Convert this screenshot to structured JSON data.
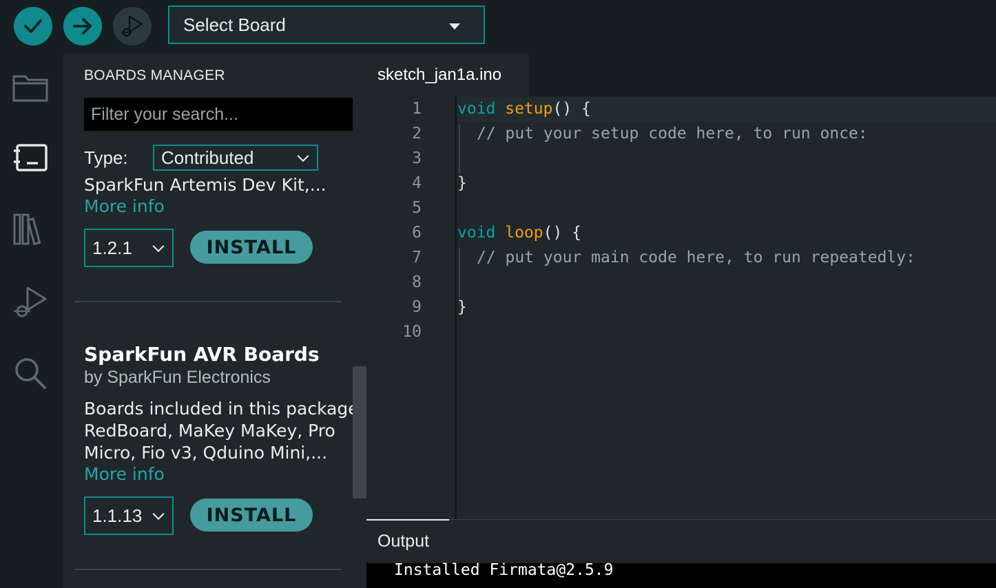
{
  "toolbar": {
    "verify_icon": "check-icon",
    "upload_icon": "arrow-right-icon",
    "debug_icon": "debug-play-icon",
    "board_select_label": "Select Board"
  },
  "activity_bar": {
    "items": [
      "folder-icon",
      "board-icon",
      "library-icon",
      "debug-icon",
      "search-icon"
    ],
    "active": "board-icon"
  },
  "boards_manager": {
    "title": "BOARDS MANAGER",
    "filter_placeholder": "Filter your search...",
    "type_label": "Type:",
    "type_value": "Contributed",
    "entries": [
      {
        "description": "SparkFun Artemis Dev Kit,...",
        "more_info": "More info",
        "version": "1.2.1",
        "install_label": "INSTALL"
      },
      {
        "name": "SparkFun AVR Boards",
        "author": "by SparkFun Electronics",
        "description_lines": [
          "Boards included in this package:",
          "RedBoard, MaKey MaKey, Pro",
          "Micro, Fio v3, Qduino Mini,..."
        ],
        "more_info": "More info",
        "version": "1.1.13",
        "install_label": "INSTALL"
      }
    ]
  },
  "editor": {
    "tab_name": "sketch_jan1a.ino",
    "line_numbers": [
      "1",
      "2",
      "3",
      "4",
      "5",
      "6",
      "7",
      "8",
      "9",
      "10"
    ],
    "lines": {
      "l1_kw": "void",
      "l1_fn": "setup",
      "l1_rest": "() {",
      "l2_comment": "// put your setup code here, to run once:",
      "l4": "}",
      "l6_kw": "void",
      "l6_fn": "loop",
      "l6_rest": "() {",
      "l7_comment": "// put your main code here, to run repeatedly:",
      "l9": "}"
    }
  },
  "output": {
    "title": "Output",
    "text": "Installed Firmata@2.5.9"
  },
  "colors": {
    "accent": "#0f8b8d",
    "keyword": "#0ca1a6",
    "function": "#f39c12",
    "link": "#2aa3a6"
  }
}
